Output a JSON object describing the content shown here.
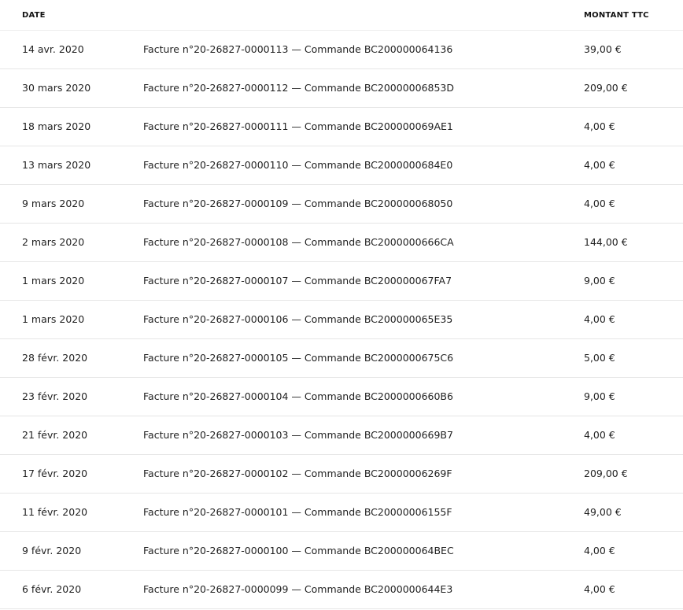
{
  "table": {
    "headers": {
      "date": "DATE",
      "amount": "MONTANT TTC"
    },
    "rows": [
      {
        "date": "14 avr. 2020",
        "description": "Facture n°20-26827-0000113 — Commande BC200000064136",
        "amount": "39,00 €"
      },
      {
        "date": "30 mars 2020",
        "description": "Facture n°20-26827-0000112 — Commande BC20000006853D",
        "amount": "209,00 €"
      },
      {
        "date": "18 mars 2020",
        "description": "Facture n°20-26827-0000111 — Commande BC200000069AE1",
        "amount": "4,00 €"
      },
      {
        "date": "13 mars 2020",
        "description": "Facture n°20-26827-0000110 — Commande BC2000000684E0",
        "amount": "4,00 €"
      },
      {
        "date": "9 mars 2020",
        "description": "Facture n°20-26827-0000109 — Commande BC200000068050",
        "amount": "4,00 €"
      },
      {
        "date": "2 mars 2020",
        "description": "Facture n°20-26827-0000108 — Commande BC2000000666CA",
        "amount": "144,00 €"
      },
      {
        "date": "1 mars 2020",
        "description": "Facture n°20-26827-0000107 — Commande BC200000067FA7",
        "amount": "9,00 €"
      },
      {
        "date": "1 mars 2020",
        "description": "Facture n°20-26827-0000106 — Commande BC200000065E35",
        "amount": "4,00 €"
      },
      {
        "date": "28 févr. 2020",
        "description": "Facture n°20-26827-0000105 — Commande BC2000000675C6",
        "amount": "5,00 €"
      },
      {
        "date": "23 févr. 2020",
        "description": "Facture n°20-26827-0000104 — Commande BC2000000660B6",
        "amount": "9,00 €"
      },
      {
        "date": "21 févr. 2020",
        "description": "Facture n°20-26827-0000103 — Commande BC2000000669B7",
        "amount": "4,00 €"
      },
      {
        "date": "17 févr. 2020",
        "description": "Facture n°20-26827-0000102 — Commande BC20000006269F",
        "amount": "209,00 €"
      },
      {
        "date": "11 févr. 2020",
        "description": "Facture n°20-26827-0000101 — Commande BC20000006155F",
        "amount": "49,00 €"
      },
      {
        "date": "9 févr. 2020",
        "description": "Facture n°20-26827-0000100 — Commande BC200000064BEC",
        "amount": "4,00 €"
      },
      {
        "date": "6 févr. 2020",
        "description": "Facture n°20-26827-0000099 — Commande BC2000000644E3",
        "amount": "4,00 €"
      }
    ]
  }
}
